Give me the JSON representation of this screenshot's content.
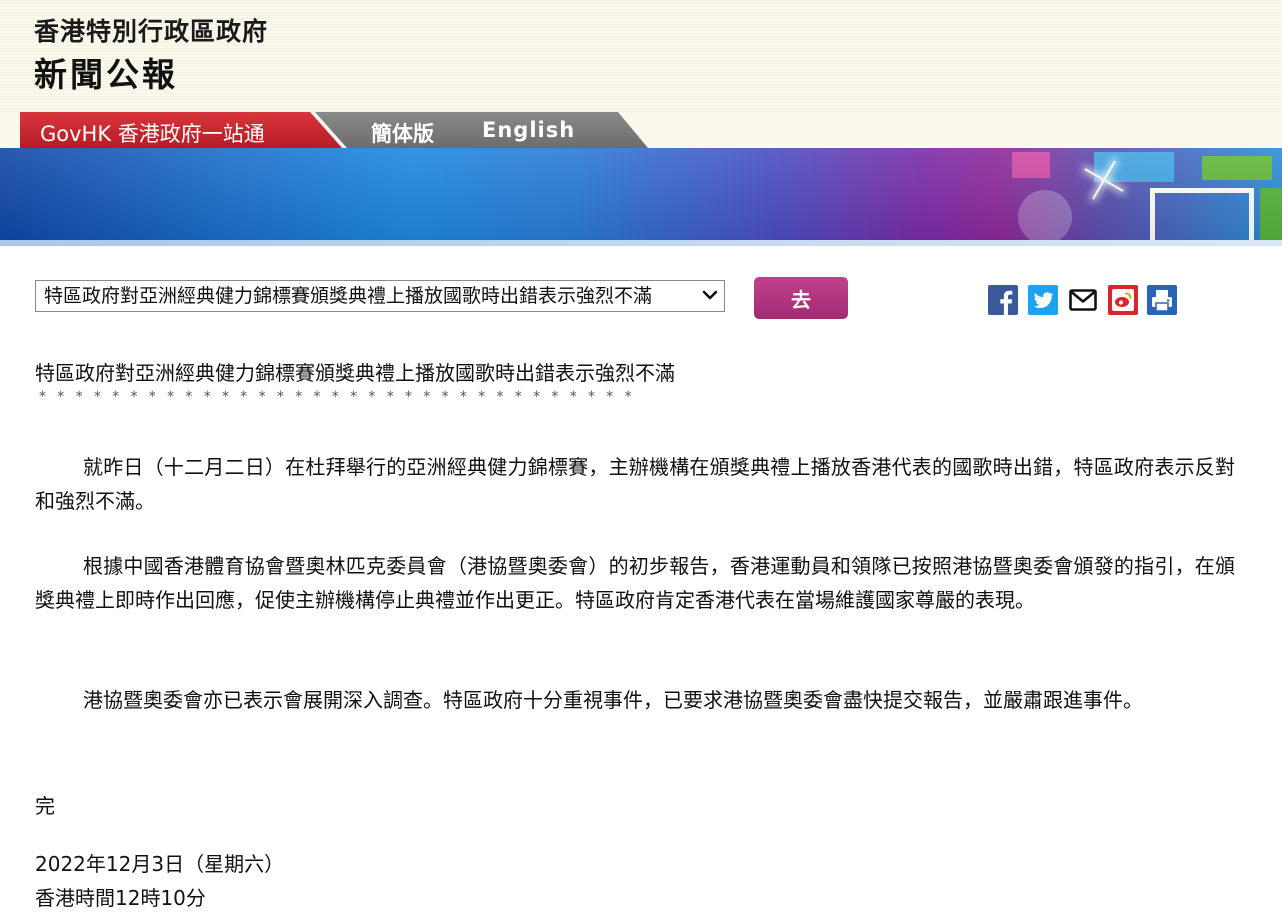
{
  "header": {
    "government_name": "香港特別行政區政府",
    "site_title": "新聞公報"
  },
  "nav": {
    "govhk_label": "GovHK 香港政府一站通",
    "simplified_label": "簡体版",
    "english_label": "English"
  },
  "toolbar": {
    "news_select_value": "特區政府對亞洲經典健力錦標賽頒獎典禮上播放國歌時出錯表示強烈不滿",
    "go_label": "去"
  },
  "share_icons": {
    "facebook": "facebook-icon",
    "twitter": "twitter-icon",
    "email": "email-icon",
    "weibo": "weibo-icon",
    "print": "print-icon"
  },
  "colors": {
    "nav_red": "#c8262e",
    "go_button": "#b0357f",
    "facebook": "#3b5998",
    "twitter": "#1da1f2",
    "weibo": "#d9262e",
    "print": "#2a64b4"
  },
  "article": {
    "title": "特區政府對亞洲經典健力錦標賽頒獎典禮上播放國歌時出錯表示強烈不滿",
    "separator": "*********************************",
    "paragraphs": [
      "就昨日（十二月二日）在杜拜舉行的亞洲經典健力錦標賽，主辦機構在頒獎典禮上播放香港代表的國歌時出錯，特區政府表示反對和強烈不滿。",
      "根據中國香港體育協會暨奧林匹克委員會（港協暨奧委會）的初步報告，香港運動員和領隊已按照港協暨奧委會頒發的指引，在頒獎典禮上即時作出回應，促使主辦機構停止典禮並作出更正。特區政府肯定香港代表在當場維護國家尊嚴的表現。",
      "港協暨奧委會亦已表示會展開深入調查。特區政府十分重視事件，已要求港協暨奧委會盡快提交報告，並嚴肅跟進事件。"
    ],
    "end_mark": "完",
    "date": "2022年12月3日（星期六）",
    "time": "香港時間12時10分"
  }
}
